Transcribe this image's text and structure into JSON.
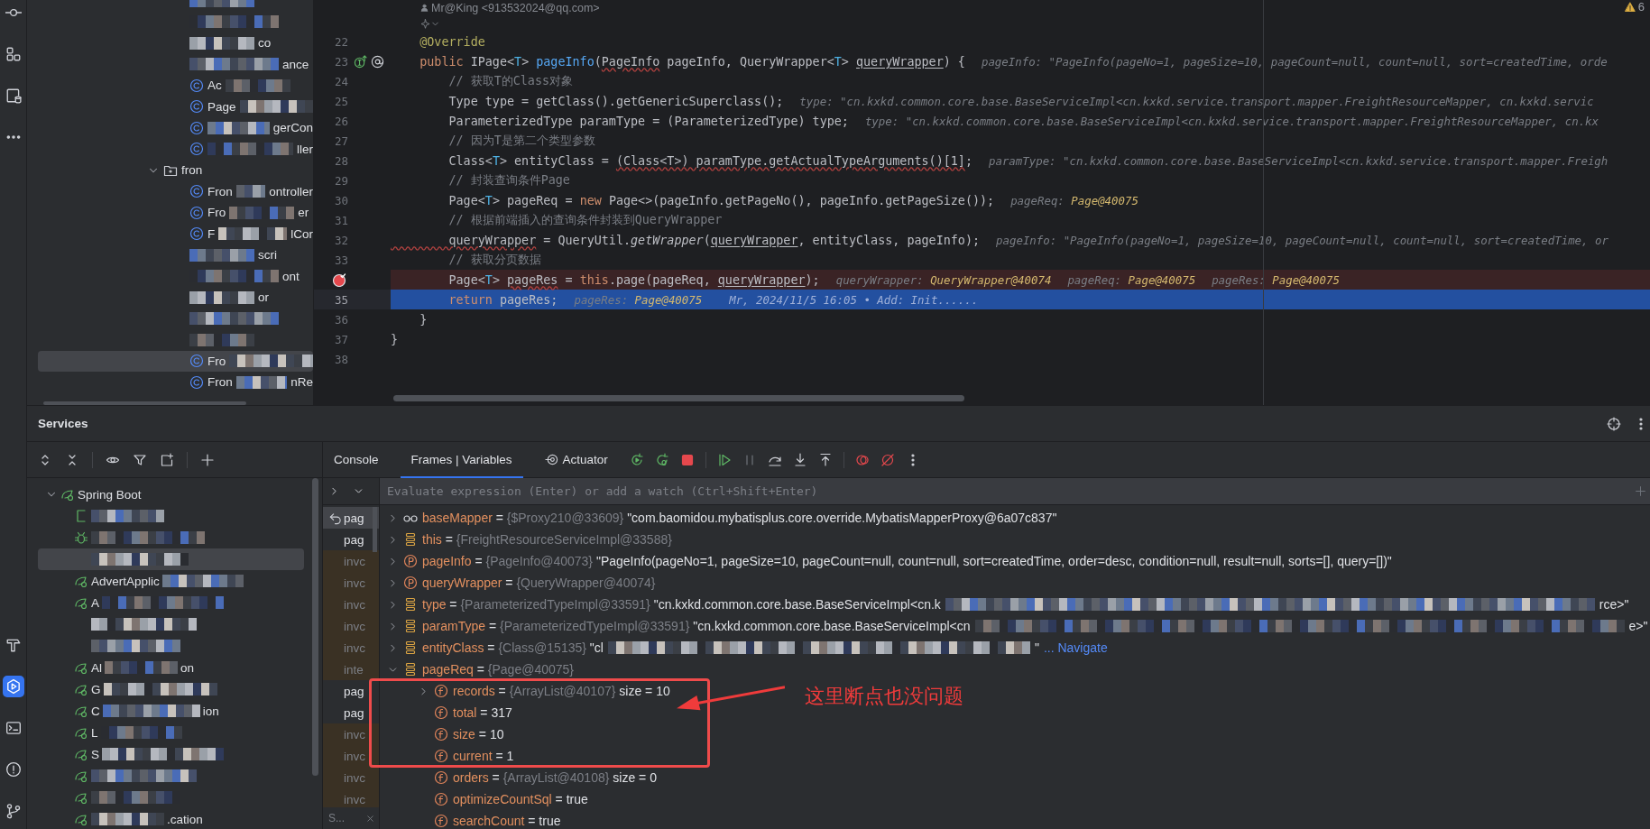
{
  "project_tree": {
    "items": [
      {
        "kind": "blurred",
        "redacted": true,
        "selected": false
      },
      {
        "kind": "blurred",
        "redacted": true,
        "selected": false
      },
      {
        "kind": "blurred",
        "redacted": true,
        "after": "co",
        "selected": false
      },
      {
        "kind": "blurred",
        "redacted": true,
        "after": "ance",
        "selected": false
      },
      {
        "kind": "class",
        "before": "Ac",
        "redacted": true,
        "selected": false
      },
      {
        "kind": "class",
        "before": "Page",
        "redacted": true,
        "selected": false
      },
      {
        "kind": "class",
        "redacted": true,
        "after": "gerCon",
        "selected": false
      },
      {
        "kind": "class",
        "redacted": true,
        "after": "ller",
        "selected": false
      },
      {
        "kind": "folder",
        "before": "fron",
        "redacted": false,
        "expanded": true,
        "selected": false
      },
      {
        "kind": "class",
        "before": "Fron",
        "redacted": true,
        "after": "ontroller",
        "selected": false
      },
      {
        "kind": "class",
        "before": "Fro",
        "redacted": true,
        "after": "er",
        "selected": false
      },
      {
        "kind": "class",
        "before": "F",
        "redacted": true,
        "after": "lCor",
        "selected": false
      },
      {
        "kind": "blurred",
        "redacted": true,
        "after": "scri",
        "selected": false
      },
      {
        "kind": "blurred",
        "redacted": true,
        "after": "ont",
        "selected": false
      },
      {
        "kind": "blurred",
        "redacted": true,
        "after": "or",
        "selected": false
      },
      {
        "kind": "blurred",
        "redacted": true,
        "selected": false
      },
      {
        "kind": "blurred",
        "redacted": true,
        "selected": false
      },
      {
        "kind": "class",
        "before": "Fro",
        "redacted": true,
        "selected": true
      },
      {
        "kind": "class",
        "before": "Fron",
        "redacted": true,
        "after": "nRe",
        "selected": false
      }
    ]
  },
  "editor": {
    "author": "Mr@King <913532024@qq.com>",
    "problems_count": "6",
    "lines": [
      {
        "number": "22",
        "breakpoint": false,
        "current": false,
        "segs": [
          {
            "kind": "annotation",
            "text": "    @Override"
          }
        ]
      },
      {
        "number": "23",
        "breakpoint": false,
        "current": false,
        "gutter": [
          {
            "kind": "implements"
          },
          {
            "kind": "annotation"
          }
        ],
        "segs": [
          {
            "kind": "keyword",
            "text": "    public "
          },
          {
            "kind": "plain",
            "text": "IPage<"
          },
          {
            "kind": "type_param",
            "text": "T"
          },
          {
            "kind": "plain",
            "text": "> "
          },
          {
            "kind": "method",
            "text": "pageInfo"
          },
          {
            "kind": "plain",
            "text": "("
          },
          {
            "kind": "warning",
            "text": "PageInfo"
          },
          {
            "kind": "plain",
            "text": " pageInfo, QueryWrapper<"
          },
          {
            "kind": "type_param",
            "text": "T"
          },
          {
            "kind": "plain",
            "text": "> "
          },
          {
            "kind": "usage",
            "text": "queryWrapper"
          },
          {
            "kind": "plain",
            "text": ") {"
          }
        ],
        "hints": [
          {
            "name": "pageInfo:",
            "value": "\"PageInfo(pageNo=1, pageSize=10, pageCount=null, count=null, sort=createdTime, orde",
            "kind": "string"
          }
        ]
      },
      {
        "number": "24",
        "breakpoint": false,
        "current": false,
        "segs": [
          {
            "kind": "comment",
            "text": "        // 获取T的Class对象"
          }
        ]
      },
      {
        "number": "25",
        "breakpoint": false,
        "current": false,
        "segs": [
          {
            "kind": "plain",
            "text": "        Type type = getClass().getGenericSuperclass();"
          }
        ],
        "hints": [
          {
            "name": "type:",
            "value": "\"cn.kxkd.common.core.base.BaseServiceImpl<cn.kxkd.service.transport.mapper.FreightResourceMapper, cn.kxkd.servic",
            "kind": "string"
          }
        ]
      },
      {
        "number": "26",
        "breakpoint": false,
        "current": false,
        "segs": [
          {
            "kind": "plain",
            "text": "        ParameterizedType paramType = (ParameterizedType) type;"
          }
        ],
        "hints": [
          {
            "name": "type:",
            "value": "\"cn.kxkd.common.core.base.BaseServiceImpl<cn.kxkd.service.transport.mapper.FreightResourceMapper, cn.kx",
            "kind": "string"
          }
        ]
      },
      {
        "number": "27",
        "breakpoint": false,
        "current": false,
        "segs": [
          {
            "kind": "comment",
            "text": "        // 因为T是第二个类型参数"
          }
        ]
      },
      {
        "number": "28",
        "breakpoint": false,
        "current": false,
        "segs": [
          {
            "kind": "plain",
            "text": "        Class<"
          },
          {
            "kind": "type_param",
            "text": "T"
          },
          {
            "kind": "plain",
            "text": "> entityClass = "
          },
          {
            "kind": "warning",
            "text": "(Class<T>) paramType.getActualTypeArguments()[1]"
          },
          {
            "kind": "plain",
            "text": ";"
          }
        ],
        "hints": [
          {
            "name": "paramType:",
            "value": "\"cn.kxkd.common.core.base.BaseServiceImpl<cn.kxkd.service.transport.mapper.Freigh",
            "kind": "string"
          }
        ]
      },
      {
        "number": "29",
        "breakpoint": false,
        "current": false,
        "segs": [
          {
            "kind": "comment",
            "text": "        // 封装查询条件Page"
          }
        ]
      },
      {
        "number": "30",
        "breakpoint": false,
        "current": false,
        "segs": [
          {
            "kind": "plain",
            "text": "        Page<"
          },
          {
            "kind": "type_param",
            "text": "T"
          },
          {
            "kind": "plain",
            "text": "> pageReq = "
          },
          {
            "kind": "keyword",
            "text": "new "
          },
          {
            "kind": "plain",
            "text": "Page<>(pageInfo.getPageNo(), pageInfo.getPageSize());"
          }
        ],
        "hints": [
          {
            "name": "pageReq:",
            "value": "Page@40075",
            "kind": "ref"
          }
        ]
      },
      {
        "number": "31",
        "breakpoint": false,
        "current": false,
        "segs": [
          {
            "kind": "comment",
            "text": "        // 根据前端插入的查询条件封装到QueryWrapper"
          }
        ]
      },
      {
        "number": "32",
        "breakpoint": false,
        "current": false,
        "segs": [
          {
            "kind": "warning",
            "text": "        queryWrapper"
          },
          {
            "kind": "plain",
            "text": " = QueryUtil."
          },
          {
            "kind": "static_call",
            "text": "getWrapper"
          },
          {
            "kind": "plain",
            "text": "("
          },
          {
            "kind": "usage",
            "text": "queryWrapper"
          },
          {
            "kind": "plain",
            "text": ", entityClass, pageInfo);"
          }
        ],
        "hints": [
          {
            "name": "pageInfo:",
            "value": "\"PageInfo(pageNo=1, pageSize=10, pageCount=null, count=null, sort=createdTime, or",
            "kind": "string"
          }
        ]
      },
      {
        "number": "33",
        "breakpoint": false,
        "current": false,
        "segs": [
          {
            "kind": "comment",
            "text": "        // 获取分页数据"
          }
        ]
      },
      {
        "breakpoint": true,
        "current": false,
        "segs": [
          {
            "kind": "plain",
            "text": "        Page<"
          },
          {
            "kind": "type_param",
            "text": "T"
          },
          {
            "kind": "plain",
            "text": "> "
          },
          {
            "kind": "warning",
            "text": "pageRes"
          },
          {
            "kind": "plain",
            "text": " = "
          },
          {
            "kind": "keyword",
            "text": "this"
          },
          {
            "kind": "plain",
            "text": ".page(pageReq, "
          },
          {
            "kind": "usage",
            "text": "queryWrapper"
          },
          {
            "kind": "plain",
            "text": ");"
          }
        ],
        "hints": [
          {
            "name": "queryWrapper:",
            "value": "QueryWrapper@40074",
            "kind": "ref"
          },
          {
            "name": "pageReq:",
            "value": "Page@40075",
            "kind": "ref"
          },
          {
            "name": "pageRes:",
            "value": "Page@40075",
            "kind": "ref"
          }
        ]
      },
      {
        "number": "35",
        "breakpoint": false,
        "current": true,
        "segs": [
          {
            "kind": "keyword",
            "text": "        return"
          },
          {
            "kind": "plain",
            "text": " pageRes;"
          }
        ],
        "hints": [
          {
            "name": "pageRes:",
            "value": "Page@40075",
            "kind": "ref"
          }
        ],
        "blame": "Mr, 2024/11/5 16:05 • Add: Init......"
      },
      {
        "number": "36",
        "breakpoint": false,
        "current": false,
        "segs": [
          {
            "kind": "plain",
            "text": "    }"
          }
        ]
      },
      {
        "number": "37",
        "breakpoint": false,
        "current": false,
        "segs": [
          {
            "kind": "plain",
            "text": "}"
          }
        ]
      },
      {
        "number": "38",
        "breakpoint": false,
        "current": false
      }
    ]
  },
  "services": {
    "title": "Services",
    "root": {
      "label": "Spring Boot",
      "expanded": true,
      "children": [
        {
          "kind": "bracket",
          "redacted": true,
          "selected": false
        },
        {
          "kind": "bug",
          "redacted": true,
          "selected": false
        },
        {
          "kind": "blurred",
          "redacted": true,
          "selected": true
        },
        {
          "kind": "app",
          "before": "AdvertApplic",
          "redacted": true,
          "selected": false
        },
        {
          "kind": "app",
          "before": "A",
          "redacted": true,
          "selected": false
        },
        {
          "kind": "blurred",
          "redacted": true,
          "selected": false
        },
        {
          "kind": "blurred",
          "redacted": true,
          "selected": false
        },
        {
          "kind": "app",
          "before": "Al",
          "redacted": true,
          "after": "on",
          "selected": false
        },
        {
          "kind": "app",
          "before": "G",
          "redacted": true,
          "selected": false
        },
        {
          "kind": "app",
          "before": "C",
          "redacted": true,
          "after": "ion",
          "selected": false
        },
        {
          "kind": "app",
          "before": "L",
          "redacted": true,
          "selected": false
        },
        {
          "kind": "app",
          "before": "S",
          "redacted": true,
          "selected": false
        },
        {
          "kind": "app",
          "redacted": true,
          "selected": false
        },
        {
          "kind": "app",
          "redacted": true,
          "selected": false
        },
        {
          "kind": "app",
          "redacted": true,
          "after": ".cation",
          "selected": false
        }
      ]
    }
  },
  "debugger": {
    "tabs": [
      {
        "label": "Console",
        "selected": false,
        "kind": "plain"
      },
      {
        "label": "Frames | Variables",
        "selected": true,
        "kind": "plain"
      },
      {
        "label": "Actuator",
        "selected": false,
        "kind": "actuator"
      }
    ],
    "evaluate_placeholder": "Evaluate expression (Enter) or add a watch (Ctrl+Shift+Enter)",
    "frames": [
      {
        "text": "pag",
        "kind": "app",
        "selected": true
      },
      {
        "text": "pag",
        "kind": "app",
        "selected": false
      },
      {
        "text": "invc",
        "kind": "library",
        "selected": false
      },
      {
        "text": "invc",
        "kind": "library",
        "selected": false
      },
      {
        "text": "invc",
        "kind": "library",
        "selected": false
      },
      {
        "text": "invc",
        "kind": "library",
        "selected": false
      },
      {
        "text": "invc",
        "kind": "library",
        "selected": false
      },
      {
        "text": "inte",
        "kind": "library",
        "selected": false
      },
      {
        "text": "pag",
        "kind": "app",
        "selected": false
      },
      {
        "text": "pag",
        "kind": "app",
        "selected": false
      },
      {
        "text": "invc",
        "kind": "library",
        "selected": false
      },
      {
        "text": "invc",
        "kind": "library",
        "selected": false
      },
      {
        "text": "invc",
        "kind": "library",
        "selected": false
      },
      {
        "text": "invc",
        "kind": "library",
        "selected": false
      }
    ],
    "thread_label": "S...",
    "variables": [
      {
        "name": "baseMapper",
        "kind": "watch",
        "expanded": false,
        "separator": "=",
        "ref": "{$Proxy210@33609}",
        "value": "\"com.baomidou.mybatisplus.core.override.MybatisMapperProxy@6a07c837\"",
        "redacted": false
      },
      {
        "name": "this",
        "kind": "object",
        "expanded": false,
        "separator": "=",
        "ref": "{FreightResourceServiceImpl@33588}",
        "redacted": false
      },
      {
        "name": "pageInfo",
        "kind": "param",
        "expanded": false,
        "separator": "=",
        "ref": "{PageInfo@40073}",
        "value": "\"PageInfo(pageNo=1, pageSize=10, pageCount=null, count=null, sort=createdTime, order=desc, condition=null, result=null, sorts=[], query=[])\"",
        "redacted": false
      },
      {
        "name": "queryWrapper",
        "kind": "param",
        "expanded": false,
        "separator": "=",
        "ref": "{QueryWrapper@40074}",
        "redacted": false
      },
      {
        "name": "type",
        "kind": "object",
        "expanded": false,
        "separator": "=",
        "ref": "{ParameterizedTypeImpl@33591}",
        "value": "\"cn.kxkd.common.core.base.BaseServiceImpl<cn.k",
        "redacted": true,
        "tail": "rce>\""
      },
      {
        "name": "paramType",
        "kind": "object",
        "expanded": false,
        "separator": "=",
        "ref": "{ParameterizedTypeImpl@33591}",
        "value": "\"cn.kxkd.common.core.base.BaseServiceImpl<cn",
        "redacted": true,
        "tail": "e>\""
      },
      {
        "name": "entityClass",
        "kind": "object",
        "expanded": false,
        "separator": "=",
        "ref": "{Class@15135}",
        "value": "\"cl",
        "redacted": true,
        "tail": "\"",
        "link": "... Navigate"
      },
      {
        "name": "pageReq",
        "kind": "object",
        "expanded": true,
        "separator": "=",
        "ref": "{Page@40075}",
        "redacted": false,
        "children": [
          {
            "name": "records",
            "kind": "field",
            "expanded": false,
            "separator": "=",
            "ref": "{ArrayList@40107}",
            "value": "size = 10",
            "redacted": false
          },
          {
            "name": "total",
            "kind": "field",
            "separator": "=",
            "value": "317",
            "redacted": false
          },
          {
            "name": "size",
            "kind": "field",
            "separator": "=",
            "value": "10",
            "redacted": false
          },
          {
            "name": "current",
            "kind": "field",
            "separator": "=",
            "value": "1",
            "redacted": false
          },
          {
            "name": "orders",
            "kind": "field",
            "separator": "=",
            "ref": "{ArrayList@40108}",
            "value": "size = 0",
            "redacted": false
          },
          {
            "name": "optimizeCountSql",
            "kind": "field",
            "separator": "=",
            "value": "true",
            "redacted": false
          },
          {
            "name": "searchCount",
            "kind": "field",
            "separator": "=",
            "value": "true",
            "redacted": false
          }
        ]
      }
    ]
  },
  "annotation": {
    "text": "这里断点也没问题"
  }
}
